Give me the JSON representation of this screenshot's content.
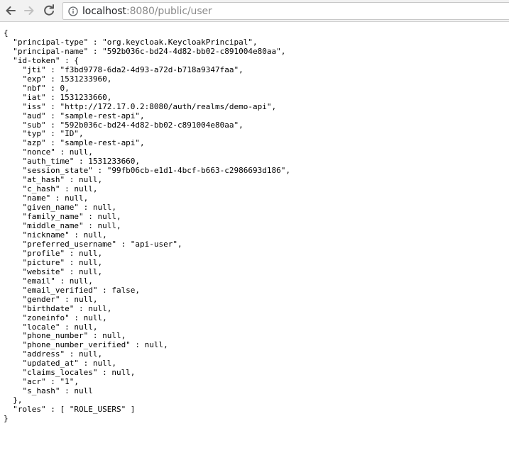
{
  "browser": {
    "url_host": "localhost",
    "url_rest": ":8080/public/user",
    "nav_icons": [
      "back-arrow-icon",
      "forward-arrow-icon",
      "reload-icon",
      "info-icon"
    ]
  },
  "json_text": "{\n  \"principal-type\" : \"org.keycloak.KeycloakPrincipal\",\n  \"principal-name\" : \"592b036c-bd24-4d82-bb02-c891004e80aa\",\n  \"id-token\" : {\n    \"jti\" : \"f3bd9778-6da2-4d93-a72d-b718a9347faa\",\n    \"exp\" : 1531233960,\n    \"nbf\" : 0,\n    \"iat\" : 1531233660,\n    \"iss\" : \"http://172.17.0.2:8080/auth/realms/demo-api\",\n    \"aud\" : \"sample-rest-api\",\n    \"sub\" : \"592b036c-bd24-4d82-bb02-c891004e80aa\",\n    \"typ\" : \"ID\",\n    \"azp\" : \"sample-rest-api\",\n    \"nonce\" : null,\n    \"auth_time\" : 1531233660,\n    \"session_state\" : \"99fb06cb-e1d1-4bcf-b663-c2986693d186\",\n    \"at_hash\" : null,\n    \"c_hash\" : null,\n    \"name\" : null,\n    \"given_name\" : null,\n    \"family_name\" : null,\n    \"middle_name\" : null,\n    \"nickname\" : null,\n    \"preferred_username\" : \"api-user\",\n    \"profile\" : null,\n    \"picture\" : null,\n    \"website\" : null,\n    \"email\" : null,\n    \"email_verified\" : false,\n    \"gender\" : null,\n    \"birthdate\" : null,\n    \"zoneinfo\" : null,\n    \"locale\" : null,\n    \"phone_number\" : null,\n    \"phone_number_verified\" : null,\n    \"address\" : null,\n    \"updated_at\" : null,\n    \"claims_locales\" : null,\n    \"acr\" : \"1\",\n    \"s_hash\" : null\n  },\n  \"roles\" : [ \"ROLE_USERS\" ]\n}"
}
